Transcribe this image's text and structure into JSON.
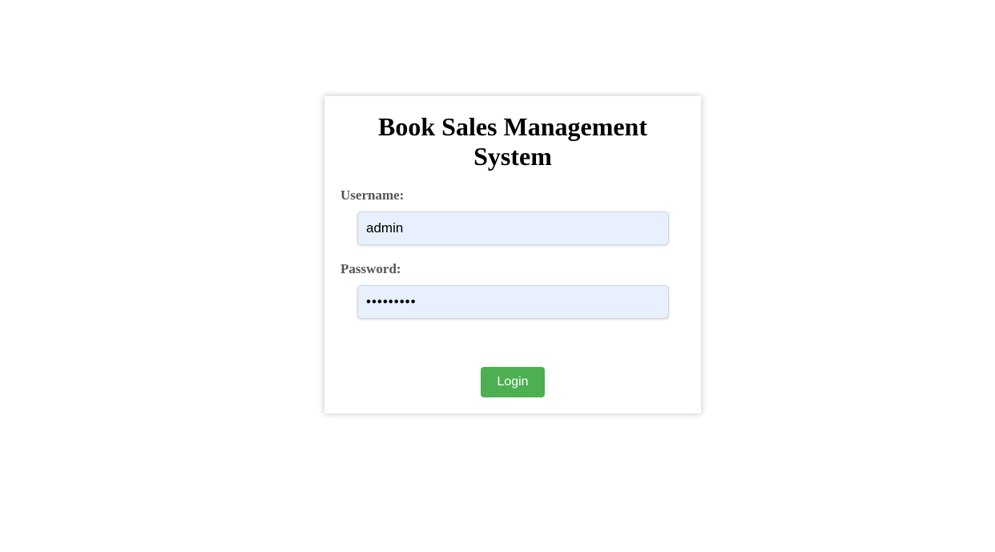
{
  "login": {
    "title_line1": "Book Sales Management",
    "title_line2": "System",
    "username_label": "Username:",
    "username_value": "admin",
    "password_label": "Password:",
    "password_value": "admin1234",
    "login_button_label": "Login"
  },
  "colors": {
    "button_bg": "#4caf50",
    "input_bg": "#e8f0fe",
    "label_color": "#555555"
  }
}
